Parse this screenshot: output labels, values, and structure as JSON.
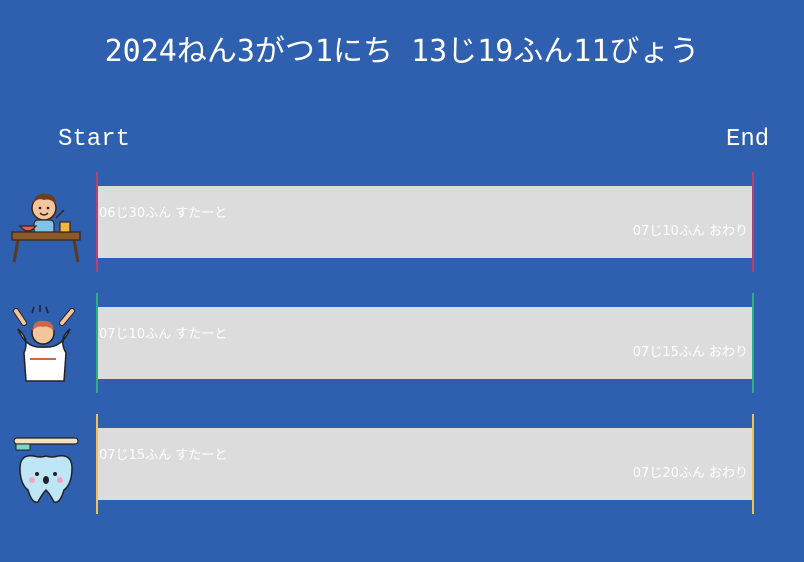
{
  "header": {
    "datetime": "2024ねん3がつ1にち 13じ19ふん11びょう"
  },
  "columns": {
    "start_label": "Start",
    "end_label": "End"
  },
  "colors": {
    "background": "#2f5faf",
    "bar": "#dcdcdc",
    "row1_marker": "#b0447a",
    "row2_marker": "#2fae7f",
    "row3_marker": "#e8c45a"
  },
  "tasks": [
    {
      "icon": "eating-breakfast-icon",
      "start_text": "06じ30ふん すたーと",
      "end_text": "07じ10ふん おわり"
    },
    {
      "icon": "getting-dressed-icon",
      "start_text": "07じ10ふん すたーと",
      "end_text": "07じ15ふん おわり"
    },
    {
      "icon": "brushing-teeth-icon",
      "start_text": "07じ15ふん すたーと",
      "end_text": "07じ20ふん おわり"
    }
  ]
}
